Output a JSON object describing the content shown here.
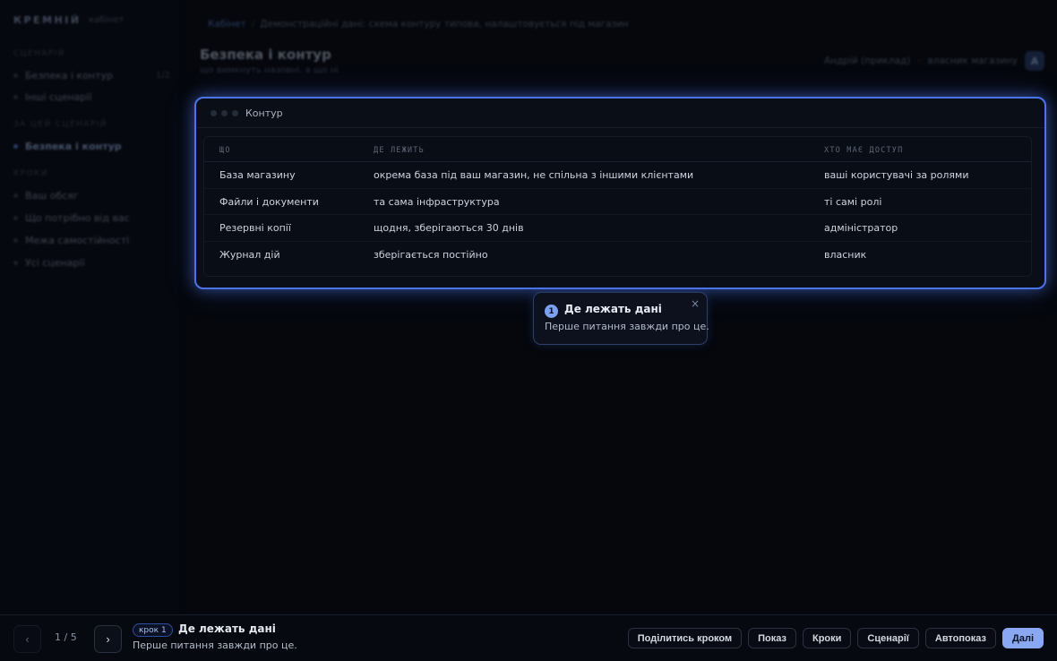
{
  "sidebar": {
    "brand": "КРЕМНІЙ",
    "brand_sub": "кабінет",
    "sections": [
      {
        "label": "СЦЕНАРІЙ",
        "items": [
          {
            "label": "Безпека і контур",
            "count": "1/2"
          },
          {
            "label": "Інші сценарії"
          }
        ]
      },
      {
        "label": "ЗА ЦЕЙ СЦЕНАРІЙ",
        "items": [
          {
            "label": "Безпека і контур",
            "active": true
          }
        ]
      },
      {
        "label": "КРОКИ",
        "items": [
          {
            "label": "Ваш обсяг"
          },
          {
            "label": "Що потрібно від вас"
          },
          {
            "label": "Межа самостійності"
          },
          {
            "label": "Усі сценарії"
          }
        ]
      }
    ]
  },
  "header": {
    "breadcrumb": {
      "link": "Кабінет",
      "text": "Демонстраційні дані: схема контуру типова, налаштовується під магазин"
    },
    "title": "Безпека і контур",
    "subtitle": "що вимкнуть назовні, а що ні",
    "user_name": "Андрій (приклад)",
    "user_role": "власник магазину",
    "avatar": "А"
  },
  "card": {
    "title": "Контур",
    "columns": [
      "Що",
      "Де лежить",
      "Хто має доступ"
    ],
    "rows": [
      [
        "База магазину",
        "окрема база під ваш магазин, не спільна з іншими клієнтами",
        "ваші користувачі за ролями"
      ],
      [
        "Файли і документи",
        "та сама інфраструктура",
        "ті самі ролі"
      ],
      [
        "Резервні копії",
        "щодня, зберігаються 30 днів",
        "адміністратор"
      ],
      [
        "Журнал дій",
        "зберігається постійно",
        "власник"
      ]
    ]
  },
  "tooltip": {
    "number": "1",
    "title": "Де лежать дані",
    "body": "Перше питання завжди про це.",
    "close": "×"
  },
  "bottombar": {
    "prev": "‹",
    "next": "›",
    "counter": "1 / 5",
    "step_label": "крок 1",
    "step_title": "Де лежать дані",
    "step_desc": "Перше питання завжди про це.",
    "buttons": {
      "share": "Поділитись кроком",
      "show": "Показ",
      "steps": "Кроки",
      "scenarios": "Сценарії",
      "autoplay": "Автопоказ",
      "next": "Далі"
    }
  },
  "colors": {
    "accent": "#4a74e8",
    "primary_button": "#8aa8f2",
    "background": "#05070d"
  }
}
